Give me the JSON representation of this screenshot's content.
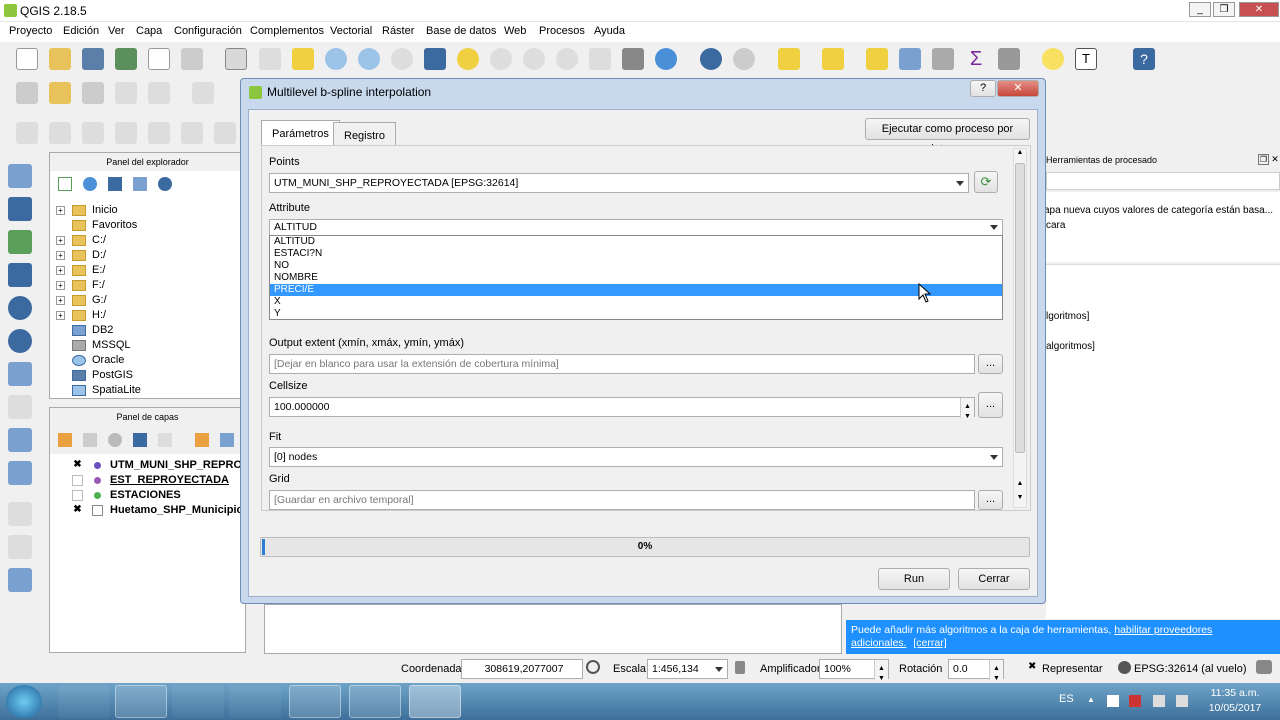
{
  "window": {
    "title": "QGIS 2.18.5"
  },
  "menu": [
    "Proyecto",
    "Edición",
    "Ver",
    "Capa",
    "Configuración",
    "Complementos",
    "Vectorial",
    "Ráster",
    "Base de datos",
    "Web",
    "Procesos",
    "Ayuda"
  ],
  "browser": {
    "title": "Panel del explorador",
    "items": [
      "Inicio",
      "Favoritos",
      "C:/",
      "D:/",
      "E:/",
      "F:/",
      "G:/",
      "H:/",
      "DB2",
      "MSSQL",
      "Oracle",
      "PostGIS",
      "SpatiaLite"
    ]
  },
  "layers": {
    "title": "Panel de capas",
    "items": [
      "UTM_MUNI_SHP_REPRO...",
      "EST_REPROYECTADA",
      "ESTACIONES",
      "Huetamo_SHP_Municipio"
    ]
  },
  "toolbox": {
    "title": "Herramientas de procesado",
    "text1": "apa nueva cuyos valores de categoría están basa...",
    "text2": "cara",
    "text3": "lgoritmos]",
    "text4": "algoritmos]",
    "notice": "Puede añadir más algoritmos a la caja de herramientas,",
    "link1": "habilitar proveedores",
    "link2": "adicionales.",
    "close": "[cerrar]"
  },
  "dialog": {
    "title": "Multilevel b-spline interpolation",
    "tab_params": "Parámetros",
    "tab_log": "Registro",
    "batch": "Ejecutar como proceso por lotes...",
    "points_label": "Points",
    "points_value": "UTM_MUNI_SHP_REPROYECTADA [EPSG:32614]",
    "attribute_label": "Attribute",
    "attribute_value": "ALTITUD",
    "attribute_options": [
      "ALTITUD",
      "ESTACI?N",
      "NO",
      "NOMBRE",
      "PRECI/E",
      "X",
      "Y"
    ],
    "selected_option": "PRECI/E",
    "extent_label": "Output extent (xmín, xmáx, ymín, ymáx)",
    "extent_placeholder": "[Dejar en blanco para usar la extensión de cobertura mínima]",
    "cellsize_label": "Cellsize",
    "cellsize_value": "100.000000",
    "fit_label": "Fit",
    "fit_value": "[0] nodes",
    "grid_label": "Grid",
    "grid_placeholder": "[Guardar en archivo temporal]",
    "ellipsis": "...",
    "progress": "0%",
    "run": "Run",
    "cancel": "Cerrar"
  },
  "status": {
    "coord_label": "Coordenada",
    "coord_value": "308619,2077007",
    "scale_label": "Escala",
    "scale_value": "1:456,134",
    "magnifier_label": "Amplificador",
    "magnifier_value": "100%",
    "rotation_label": "Rotación",
    "rotation_value": "0.0",
    "render": "Representar",
    "crs": "EPSG:32614 (al vuelo)"
  },
  "taskbar": {
    "lang": "ES",
    "time": "11:35 a.m.",
    "date": "10/05/2017"
  }
}
